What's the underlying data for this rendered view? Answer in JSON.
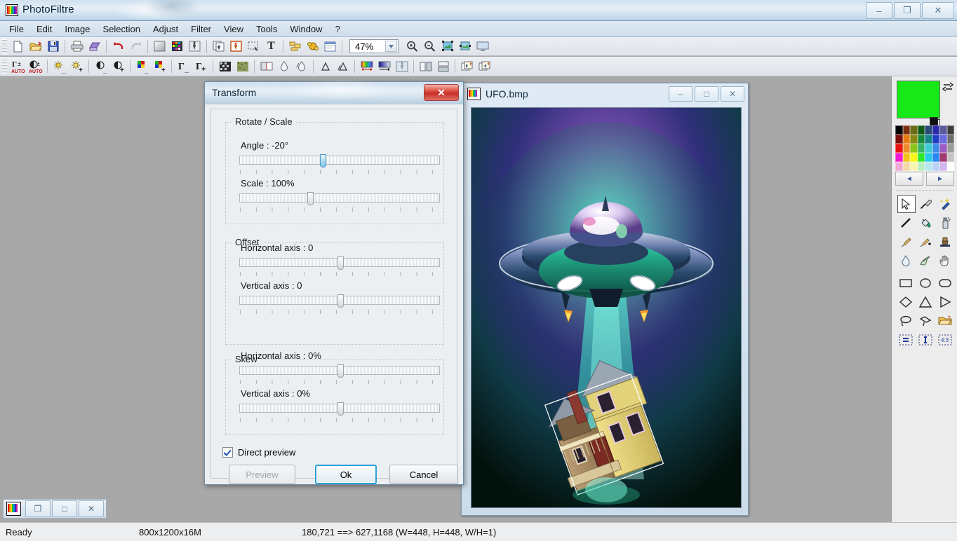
{
  "app": {
    "title": "PhotoFiltre",
    "icon": "photofiltre-icon",
    "window_controls": {
      "minimize": "–",
      "restore": "❐",
      "close": "✕"
    }
  },
  "menubar": {
    "items": [
      {
        "label": "File"
      },
      {
        "label": "Edit"
      },
      {
        "label": "Image"
      },
      {
        "label": "Selection"
      },
      {
        "label": "Adjust"
      },
      {
        "label": "Filter"
      },
      {
        "label": "View"
      },
      {
        "label": "Tools"
      },
      {
        "label": "Window"
      },
      {
        "label": "?"
      }
    ]
  },
  "toolbar_main": {
    "zoom_value": "47%",
    "buttons": [
      {
        "name": "new-icon"
      },
      {
        "name": "open-icon"
      },
      {
        "name": "save-icon"
      },
      {
        "name": "print-icon"
      },
      {
        "name": "print-preview-icon"
      },
      {
        "name": "undo-icon"
      },
      {
        "name": "redo-icon"
      },
      {
        "name": "gradient-icon"
      },
      {
        "name": "palette-icon"
      },
      {
        "name": "mask-icon"
      },
      {
        "name": "copy-image-icon"
      },
      {
        "name": "paste-image-icon"
      },
      {
        "name": "selection-icon"
      },
      {
        "name": "text-icon"
      },
      {
        "name": "layers-icon"
      },
      {
        "name": "effects-icon"
      },
      {
        "name": "explorer-icon"
      },
      {
        "name": "zoom-in-icon"
      },
      {
        "name": "zoom-out-icon"
      },
      {
        "name": "fit-image-icon"
      },
      {
        "name": "actual-size-icon"
      },
      {
        "name": "fullscreen-icon"
      }
    ]
  },
  "toolbar_adjust": {
    "buttons": [
      {
        "name": "auto-levels-icon"
      },
      {
        "name": "auto-contrast-icon"
      },
      {
        "name": "brightness-down-icon"
      },
      {
        "name": "brightness-up-icon"
      },
      {
        "name": "contrast-down-icon"
      },
      {
        "name": "contrast-up-icon"
      },
      {
        "name": "saturation-down-icon"
      },
      {
        "name": "saturation-up-icon"
      },
      {
        "name": "gamma-down-icon"
      },
      {
        "name": "gamma-up-icon"
      },
      {
        "name": "dither-icon"
      },
      {
        "name": "texture-icon"
      },
      {
        "name": "halftone-icon"
      },
      {
        "name": "blur-icon"
      },
      {
        "name": "blur-more-icon"
      },
      {
        "name": "sharpen-icon"
      },
      {
        "name": "sharpen-more-icon"
      },
      {
        "name": "hue-gradient-icon"
      },
      {
        "name": "color-gradient-icon"
      },
      {
        "name": "distort-icon"
      },
      {
        "name": "flip-horizontal-icon"
      },
      {
        "name": "flip-vertical-icon"
      },
      {
        "name": "rotate-left-icon"
      },
      {
        "name": "rotate-right-icon"
      }
    ]
  },
  "image_window": {
    "filename": "UFO.bmp",
    "icon": "bitmap-file-icon",
    "controls": {
      "minimize": "–",
      "maximize": "□",
      "close": "✕"
    },
    "selection": {
      "visible": true,
      "rotated": true
    }
  },
  "mdi_controls": {
    "icon": "document-icon",
    "buttons": [
      {
        "name": "restore-child-button",
        "glyph": "❐"
      },
      {
        "name": "maximize-child-button",
        "glyph": "□"
      },
      {
        "name": "close-child-button",
        "glyph": "✕"
      }
    ]
  },
  "palette": {
    "foreground_color": "#17e817",
    "background_color": "#ffffff",
    "swap_icon": "swap-colors-icon",
    "nav_prev": "◄",
    "nav_next": "►",
    "swatches": [
      "#000000",
      "#7b2d0e",
      "#6b6b17",
      "#0e5a17",
      "#2a4a7a",
      "#2a2aa8",
      "#5a5a9e",
      "#3c3c3c",
      "#7a0f0f",
      "#e87a12",
      "#8a8a12",
      "#168a3c",
      "#16868a",
      "#1f3cc4",
      "#6b6be0",
      "#6e6e6e",
      "#e81212",
      "#f08a2a",
      "#8ec41a",
      "#35b36a",
      "#3fc9d4",
      "#3f8ae8",
      "#9b5ac4",
      "#9a9a9a",
      "#f01ad0",
      "#f5c21a",
      "#f5f51a",
      "#2ae82a",
      "#2ac9e8",
      "#2a86f0",
      "#9e3a6e",
      "#c4c4c4",
      "#f0a8d4",
      "#f5d9a8",
      "#f5f5b0",
      "#b8eec0",
      "#b8e8ee",
      "#b8d2f5",
      "#d0b8ee",
      "#ffffff"
    ],
    "tools": [
      {
        "name": "tool-pointer",
        "selected": true
      },
      {
        "name": "tool-eyedropper",
        "selected": false
      },
      {
        "name": "tool-magic-wand",
        "selected": false
      },
      {
        "name": "tool-line",
        "selected": false
      },
      {
        "name": "tool-paint-bucket",
        "selected": false
      },
      {
        "name": "tool-spray",
        "selected": false
      },
      {
        "name": "tool-paintbrush",
        "selected": false
      },
      {
        "name": "tool-advanced-brush",
        "selected": false
      },
      {
        "name": "tool-clone-stamp",
        "selected": false
      },
      {
        "name": "tool-blur-drop",
        "selected": false
      },
      {
        "name": "tool-smudge",
        "selected": false
      },
      {
        "name": "tool-hand",
        "selected": false
      }
    ],
    "shapes": [
      {
        "name": "shape-rectangle"
      },
      {
        "name": "shape-ellipse"
      },
      {
        "name": "shape-rounded-rectangle"
      },
      {
        "name": "shape-diamond"
      },
      {
        "name": "shape-triangle"
      },
      {
        "name": "shape-right-triangle"
      },
      {
        "name": "shape-lasso"
      },
      {
        "name": "shape-polygon"
      },
      {
        "name": "shape-load-selection"
      },
      {
        "name": "selection-ratio-equal"
      },
      {
        "name": "selection-ratio-fixed"
      },
      {
        "name": "selection-ratio-4-3"
      }
    ]
  },
  "dialog": {
    "title": "Transform",
    "close_glyph": "✕",
    "groups": [
      {
        "legend": "Rotate / Scale",
        "controls": [
          {
            "label": "Angle : -20°",
            "value": -20,
            "thumb_pct": 41,
            "active": true
          },
          {
            "label": "Scale : 100%",
            "value": 100,
            "thumb_pct": 35,
            "active": false
          }
        ]
      },
      {
        "legend": "Offset",
        "controls": [
          {
            "label": "Horizontal axis : 0",
            "value": 0,
            "thumb_pct": 50,
            "active": false
          },
          {
            "label": "Vertical axis : 0",
            "value": 0,
            "thumb_pct": 50,
            "active": false
          }
        ]
      },
      {
        "legend": "Skew",
        "controls": [
          {
            "label": "Horizontal axis : 0%",
            "value": 0,
            "thumb_pct": 50,
            "active": false
          },
          {
            "label": "Vertical axis : 0%",
            "value": 0,
            "thumb_pct": 50,
            "active": false
          }
        ]
      }
    ],
    "checkbox": {
      "label": "Direct preview",
      "checked": true
    },
    "buttons": {
      "preview": "Preview",
      "ok": "Ok",
      "cancel": "Cancel"
    }
  },
  "statusbar": {
    "state": "Ready",
    "image_info": "800x1200x16M",
    "selection_info": "180,721 ==> 627,1168 (W=448, H=448, W/H=1)"
  }
}
